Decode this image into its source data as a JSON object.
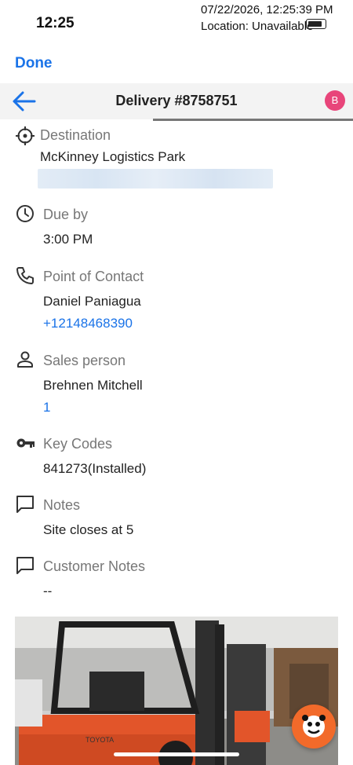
{
  "status": {
    "time": "12:25",
    "overlay_line1": "07/22/2026, 12:25:39 PM",
    "overlay_line2": "Location: Unavailable"
  },
  "top": {
    "done_label": "Done"
  },
  "nav": {
    "title": "Delivery #8758751",
    "avatar_initial": "B"
  },
  "sections": {
    "destination": {
      "label": "Destination",
      "value": "McKinney Logistics Park"
    },
    "due": {
      "label": "Due by",
      "value": "3:00 PM"
    },
    "contact": {
      "label": "Point of Contact",
      "name": "Daniel Paniagua",
      "phone": "+12148468390"
    },
    "sales": {
      "label": "Sales person",
      "name": "Brehnen Mitchell",
      "link": "1"
    },
    "keycodes": {
      "label": "Key Codes",
      "value": "841273(Installed)"
    },
    "notes": {
      "label": "Notes",
      "value": "Site closes at 5"
    },
    "customer_notes": {
      "label": "Customer Notes",
      "value": "--"
    }
  },
  "photo": {
    "brand_text": "TOYOTA"
  },
  "colors": {
    "accent": "#1a73e8",
    "avatar": "#e8457a",
    "fab": "#f26a2a",
    "forklift": "#e2552a"
  },
  "icons": [
    "back-arrow-icon",
    "crosshair-icon",
    "clock-icon",
    "phone-icon",
    "person-icon",
    "key-icon",
    "chat-icon",
    "chat-icon",
    "mascot-icon"
  ]
}
